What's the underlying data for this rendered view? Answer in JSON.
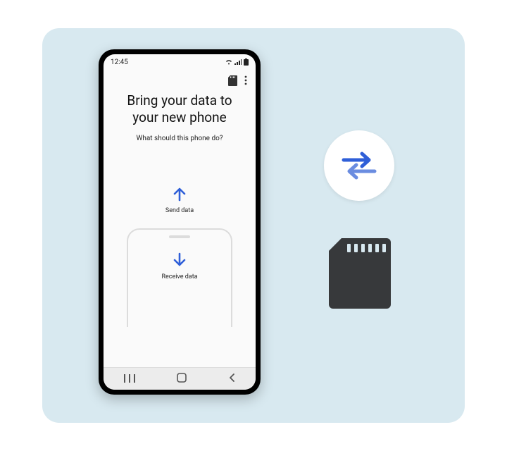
{
  "status": {
    "time": "12:45"
  },
  "header": {
    "title_line1": "Bring your data to",
    "title_line2": "your new phone",
    "subtitle": "What should this phone do?"
  },
  "actions": {
    "send": "Send data",
    "receive": "Receive data"
  },
  "icons": {
    "sd_small": "sd-card-icon",
    "overflow": "overflow-menu-icon",
    "arrow_up": "arrow-up-icon",
    "arrow_down": "arrow-down-icon",
    "swap": "swap-arrows-icon",
    "sd_large": "sd-card-large-icon",
    "nav_recent": "nav-recent-icon",
    "nav_home": "nav-home-icon",
    "nav_back": "nav-back-icon",
    "wifi": "wifi-icon",
    "signal": "signal-icon",
    "battery": "battery-icon"
  },
  "colors": {
    "accent": "#2f5fd8",
    "accent_light": "#6a8ce0",
    "bg": "#d8e9f0",
    "sd_fill": "#37393b"
  }
}
